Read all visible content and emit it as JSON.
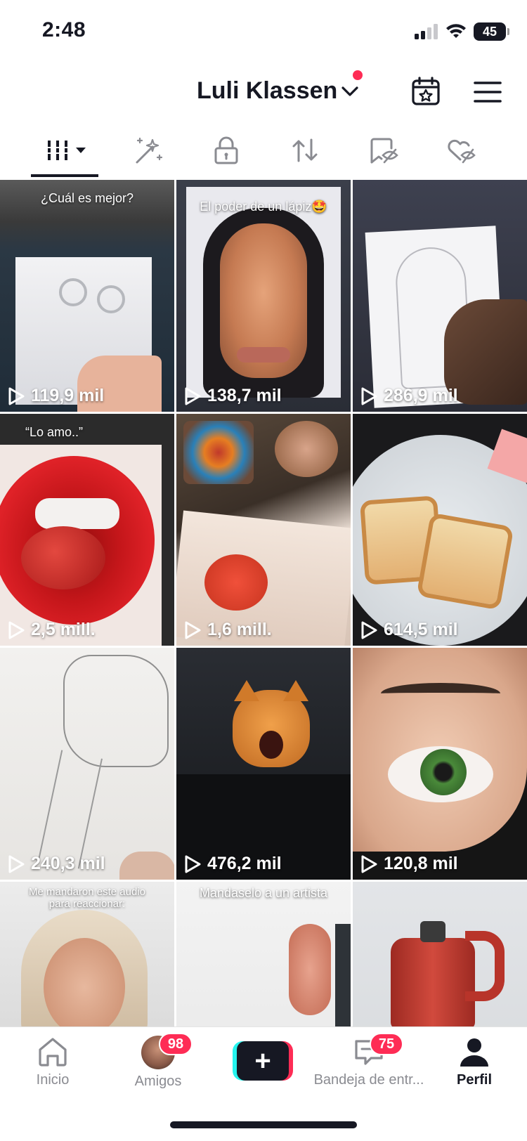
{
  "status_bar": {
    "time": "2:48",
    "battery": "45",
    "icons": [
      "cellular-icon",
      "wifi-icon",
      "battery-icon"
    ]
  },
  "header": {
    "profile_name": "Luli Klassen",
    "icons": [
      "chevron-down-icon",
      "calendar-star-icon",
      "hamburger-menu-icon"
    ]
  },
  "tabs": [
    {
      "name": "videos",
      "icon": "grid-icon"
    },
    {
      "name": "effects",
      "icon": "magic-wand-icon"
    },
    {
      "name": "private",
      "icon": "lock-icon"
    },
    {
      "name": "reposts",
      "icon": "repost-icon"
    },
    {
      "name": "favorites",
      "icon": "bookmark-hidden-icon"
    },
    {
      "name": "liked",
      "icon": "heart-hidden-icon"
    }
  ],
  "videos": [
    {
      "caption": "¿Cuál es mejor?",
      "views": "119,9 mil"
    },
    {
      "caption": "El poder de un lápiz🤩",
      "views": "138,7 mil"
    },
    {
      "caption": "",
      "views": "286,9 mil"
    },
    {
      "caption": "“Lo amo..”",
      "views": "2,5 mill."
    },
    {
      "caption": "",
      "views": "1,6 mill."
    },
    {
      "caption": "",
      "views": "614,5 mil"
    },
    {
      "caption": "",
      "views": "240,3 mil"
    },
    {
      "caption": "",
      "views": "476,2 mil"
    },
    {
      "caption": "",
      "views": "120,8 mil"
    },
    {
      "caption": "Me mandaron este audio para reaccionar:",
      "views": ""
    },
    {
      "caption": "Mandaselo a un artista",
      "views": ""
    },
    {
      "caption": "",
      "views": ""
    }
  ],
  "bottom_nav": {
    "home": "Inicio",
    "friends": "Amigos",
    "friends_badge": "98",
    "inbox": "Bandeja de entr...",
    "inbox_badge": "75",
    "profile": "Perfil",
    "create": "+"
  },
  "colors": {
    "accent": "#fe2c55",
    "cyan": "#25f4ee",
    "text": "#161823",
    "muted": "#8a8b91"
  }
}
